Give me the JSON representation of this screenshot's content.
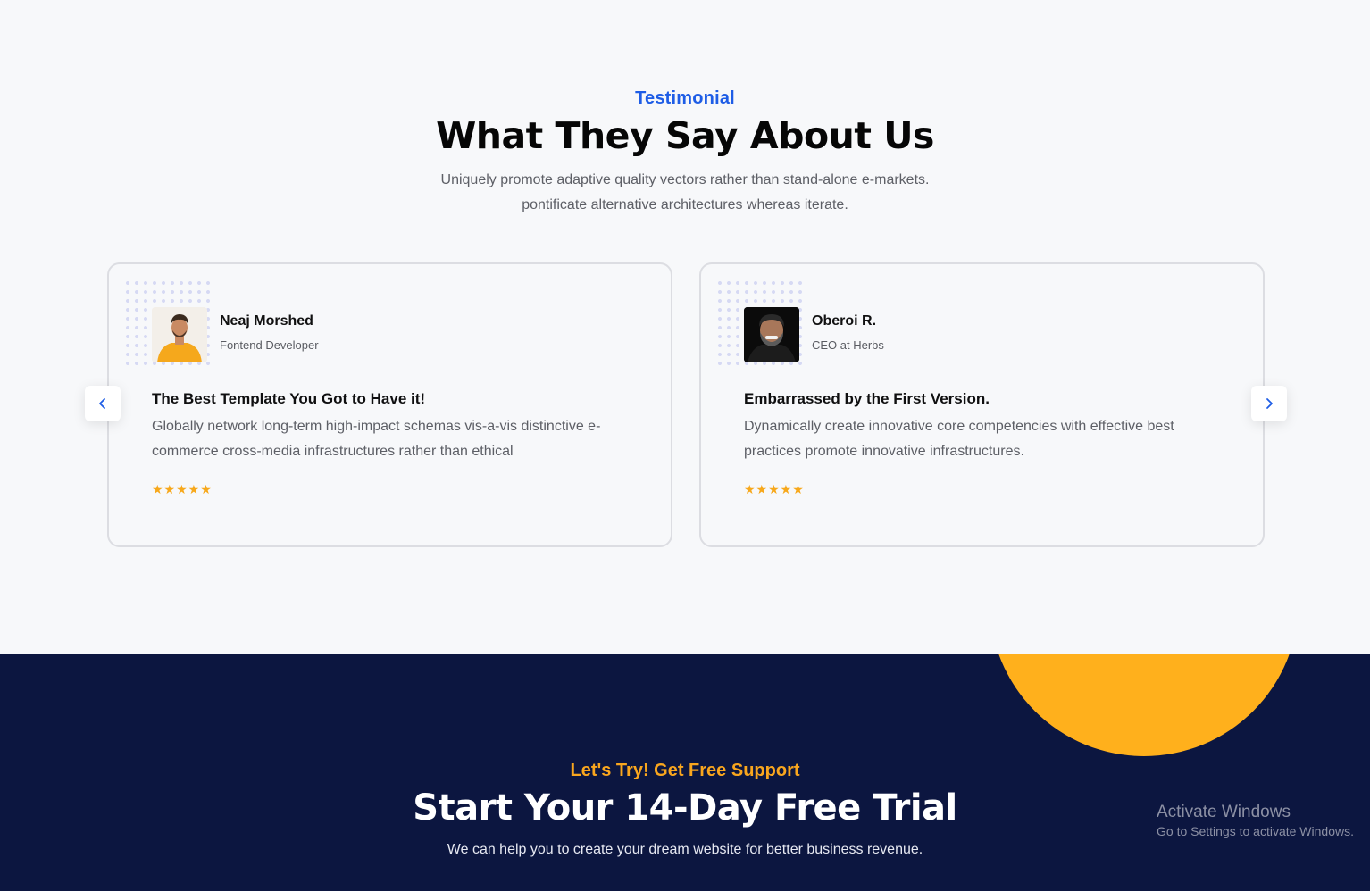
{
  "testimonials": {
    "eyebrow": "Testimonial",
    "title": "What They Say About Us",
    "subtitle_line1": "Uniquely promote adaptive quality vectors rather than stand-alone e-markets.",
    "subtitle_line2": "pontificate alternative architectures whereas iterate.",
    "cards": [
      {
        "name": "Neaj Morshed",
        "role": "Fontend Developer",
        "quote_title": "The Best Template You Got to Have it!",
        "quote_body": "Globally network long-term high-impact schemas vis-a-vis distinctive e-commerce cross-media infrastructures rather than ethical",
        "rating": 5
      },
      {
        "name": "Oberoi R.",
        "role": "CEO at Herbs",
        "quote_title": "Embarrassed by the First Version.",
        "quote_body": "Dynamically create innovative core competencies with effective best practices promote innovative infrastructures.",
        "rating": 5
      }
    ],
    "prev_icon": "chevron-left-icon",
    "next_icon": "chevron-right-icon",
    "star_glyphs": "★★★★★"
  },
  "cta": {
    "eyebrow": "Let's Try! Get Free Support",
    "title": "Start Your 14-Day Free Trial",
    "subtitle": "We can help you to create your dream website for better business revenue."
  },
  "watermark": {
    "line1": "Activate Windows",
    "line2": "Go to Settings to activate Windows."
  },
  "colors": {
    "accent_blue": "#1e5de6",
    "accent_orange": "#f9a61e",
    "dark_navy": "#0c1640",
    "star": "#f7a81b",
    "circle": "#ffb01c"
  }
}
